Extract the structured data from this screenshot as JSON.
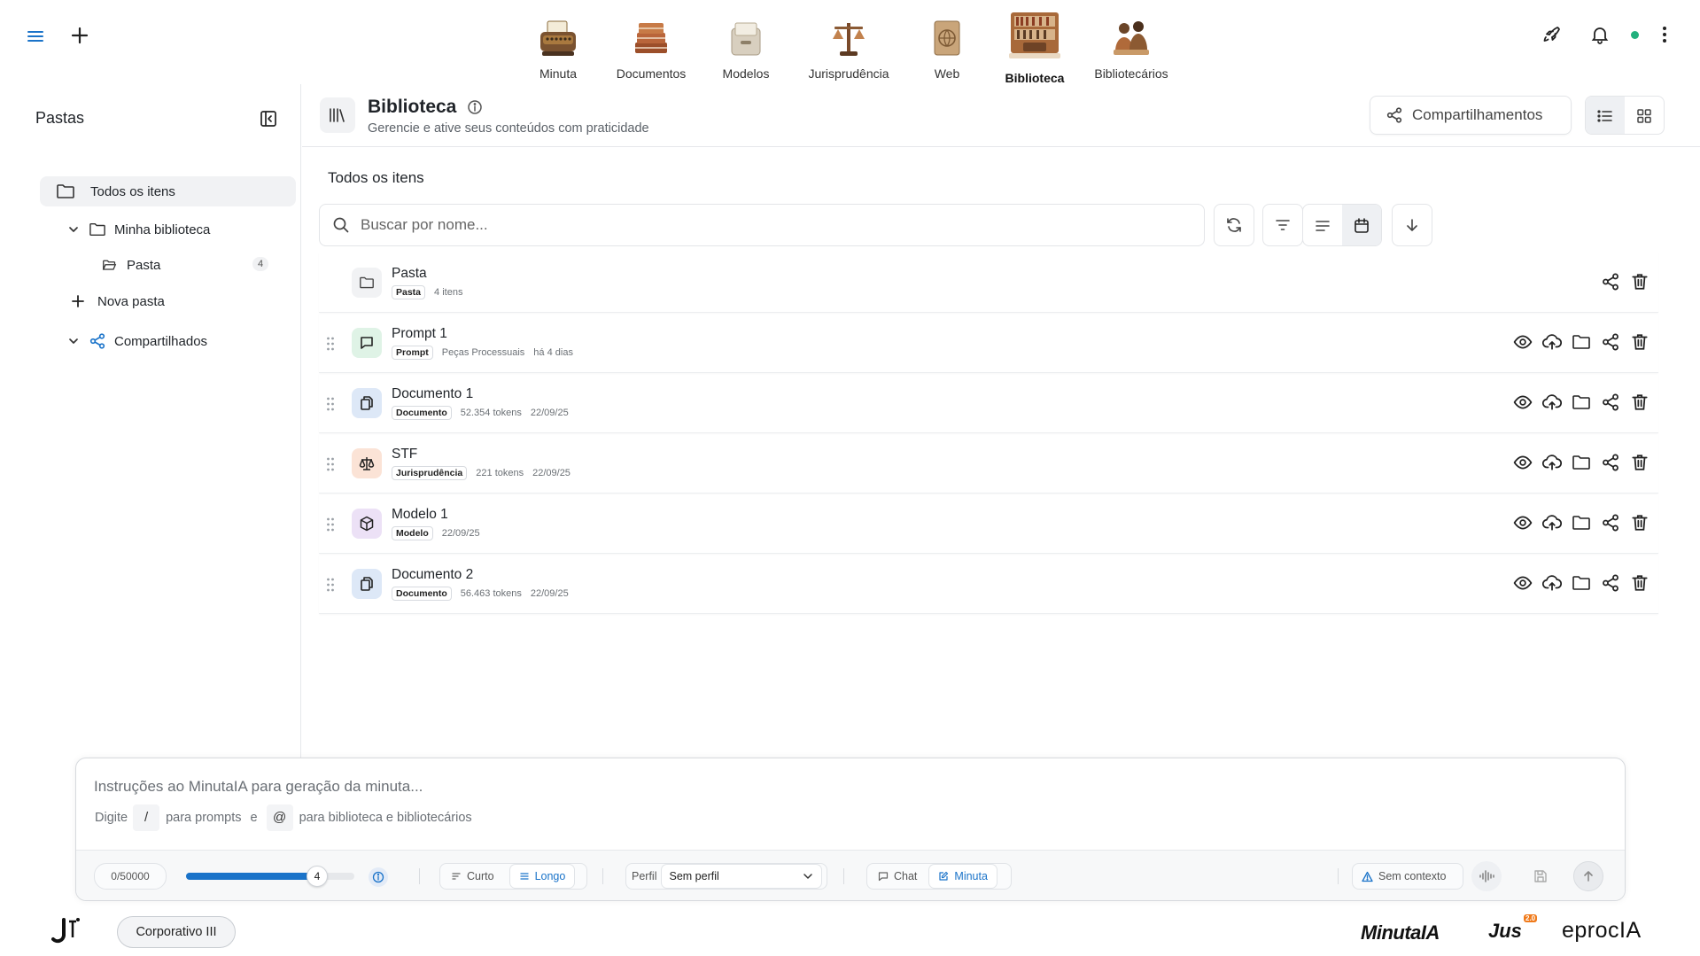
{
  "nav": [
    {
      "label": "Minuta",
      "icon": "typewriter-icon"
    },
    {
      "label": "Documentos",
      "icon": "books-icon"
    },
    {
      "label": "Modelos",
      "icon": "file-box-icon"
    },
    {
      "label": "Jurisprudência",
      "icon": "scales-icon"
    },
    {
      "label": "Web",
      "icon": "globe-book-icon"
    },
    {
      "label": "Biblioteca",
      "icon": "library-icon",
      "active": true
    },
    {
      "label": "Bibliotecários",
      "icon": "librarians-icon"
    }
  ],
  "sidebar": {
    "title": "Pastas",
    "all_items": "Todos os itens",
    "my_library": "Minha biblioteca",
    "folder": "Pasta",
    "folder_count": "4",
    "new_folder": "Nova pasta",
    "shared": "Compartilhados"
  },
  "header": {
    "title": "Biblioteca",
    "subtitle": "Gerencie e ative seus conteúdos com praticidade",
    "share_button": "Compartilhamentos"
  },
  "section_title": "Todos os itens",
  "search": {
    "placeholder": "Buscar por nome..."
  },
  "items": [
    {
      "name": "Pasta",
      "tag": "Pasta",
      "meta1": "4 itens",
      "meta2": "",
      "type": "folder"
    },
    {
      "name": "Prompt 1",
      "tag": "Prompt",
      "meta1": "Peças Processuais",
      "meta2": "há 4 dias",
      "type": "prompt"
    },
    {
      "name": "Documento 1",
      "tag": "Documento",
      "meta1": "52.354 tokens",
      "meta2": "22/09/25",
      "type": "document"
    },
    {
      "name": "STF",
      "tag": "Jurisprudência",
      "meta1": "221 tokens",
      "meta2": "22/09/25",
      "type": "jurisprudence"
    },
    {
      "name": "Modelo 1",
      "tag": "Modelo",
      "meta1": "22/09/25",
      "meta2": "",
      "type": "model"
    },
    {
      "name": "Documento 2",
      "tag": "Documento",
      "meta1": "56.463 tokens",
      "meta2": "22/09/25",
      "type": "document"
    }
  ],
  "composer": {
    "placeholder": "Instruções ao MinutaIA para geração da minuta...",
    "hint_prefix": "Digite",
    "hint_slash": "/",
    "hint_prompts": "para prompts",
    "hint_and": "e",
    "hint_at": "@",
    "hint_library": "para biblioteca e bibliotecários",
    "char_count": "0/50000",
    "slider_value": "4",
    "slider_fraction": 0.78,
    "length_short": "Curto",
    "length_long": "Longo",
    "profile_label": "Perfil",
    "profile_value": "Sem perfil",
    "mode_chat": "Chat",
    "mode_minuta": "Minuta",
    "context": "Sem contexto"
  },
  "footer": {
    "corp_button": "Corporativo III",
    "brand_minuta": "MinutaIA",
    "brand_jus": "Jus",
    "brand_jus_badge": "2.0",
    "brand_eproc": "eprocIA"
  },
  "colors": {
    "accent": "#1a73c9",
    "status_dot": "#22b07d",
    "prompt_bg": "#dff3e6",
    "document_bg": "#dde8f7",
    "jurisprudence_bg": "#fbe3d6",
    "model_bg": "#ece1f6",
    "folder_bg": "#f1f2f4"
  }
}
